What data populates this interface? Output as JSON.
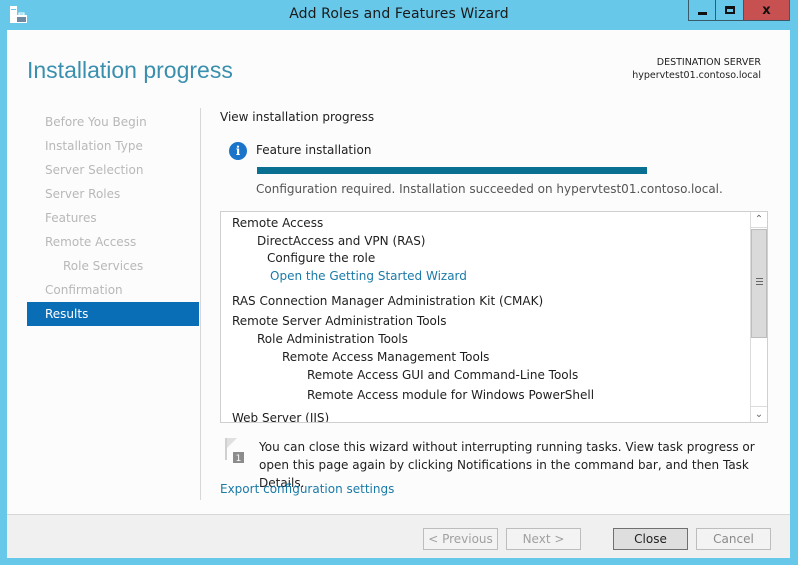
{
  "window": {
    "title": "Add Roles and Features Wizard",
    "icon": "server-manager-icon",
    "controls": {
      "minimize": "minimize-icon",
      "maximize": "maximize-icon",
      "close_glyph": "x"
    }
  },
  "header": {
    "page_title": "Installation progress",
    "destination_label": "DESTINATION SERVER",
    "destination_server": "hypervtest01.contoso.local"
  },
  "nav": {
    "items": [
      {
        "label": "Before You Begin",
        "state": "disabled",
        "level": 0
      },
      {
        "label": "Installation Type",
        "state": "disabled",
        "level": 0
      },
      {
        "label": "Server Selection",
        "state": "disabled",
        "level": 0
      },
      {
        "label": "Server Roles",
        "state": "disabled",
        "level": 0
      },
      {
        "label": "Features",
        "state": "disabled",
        "level": 0
      },
      {
        "label": "Remote Access",
        "state": "disabled",
        "level": 0
      },
      {
        "label": "Role Services",
        "state": "disabled",
        "level": 1
      },
      {
        "label": "Confirmation",
        "state": "disabled",
        "level": 0
      },
      {
        "label": "Results",
        "state": "active",
        "level": 0
      }
    ]
  },
  "main": {
    "heading": "View installation progress",
    "feature_label": "Feature installation",
    "progress_percent": 100,
    "status_text": "Configuration required. Installation succeeded on hypervtest01.contoso.local.",
    "results": [
      {
        "text": "Remote Access",
        "level": 0,
        "type": "item"
      },
      {
        "text": "DirectAccess and VPN (RAS)",
        "level": 1,
        "type": "item"
      },
      {
        "text": "Configure the role",
        "level": 2,
        "type": "item"
      },
      {
        "text": "Open the Getting Started Wizard",
        "level": 2,
        "type": "link"
      },
      {
        "text": "RAS Connection Manager Administration Kit (CMAK)",
        "level": 0,
        "type": "item"
      },
      {
        "text": "Remote Server Administration Tools",
        "level": 0,
        "type": "item"
      },
      {
        "text": "Role Administration Tools",
        "level": 1,
        "type": "item"
      },
      {
        "text": "Remote Access Management Tools",
        "level": 2,
        "type": "item"
      },
      {
        "text": "Remote Access GUI and Command-Line Tools",
        "level": 3,
        "type": "item"
      },
      {
        "text": "Remote Access module for Windows PowerShell",
        "level": 3,
        "type": "item"
      },
      {
        "text": "Web Server (IIS)",
        "level": 0,
        "type": "item"
      }
    ],
    "notice_badge": "1",
    "notice_text": "You can close this wizard without interrupting running tasks. View task progress or open this page again by clicking Notifications in the command bar, and then Task Details.",
    "export_link": "Export configuration settings"
  },
  "footer": {
    "previous": "< Previous",
    "next": "Next >",
    "close": "Close",
    "cancel": "Cancel"
  },
  "colors": {
    "chrome": "#68c8ea",
    "accent": "#0a6eb7",
    "progress": "#0a7092",
    "link": "#1a7aa8",
    "close_button": "#c75050"
  }
}
